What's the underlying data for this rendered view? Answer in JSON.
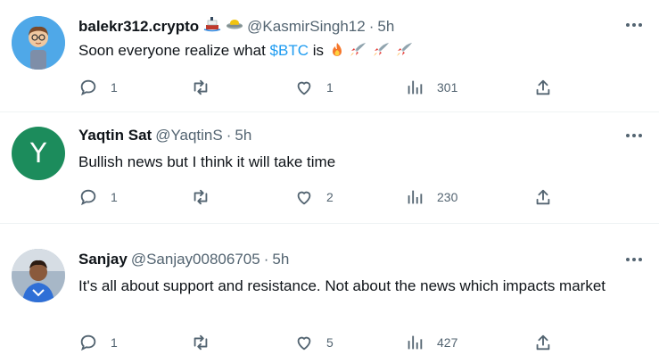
{
  "colors": {
    "accent": "#1d9bf0",
    "muted": "#536471",
    "text": "#0f1419"
  },
  "tweets": [
    {
      "name": "balekr312.crypto",
      "badges": [
        "ship-emoji",
        "flying-saucer-emoji"
      ],
      "handle": "@KasmirSingh12",
      "separator": "·",
      "time": "5h",
      "text_before": "Soon everyone realize what ",
      "cashtag": "$BTC",
      "text_after": " is ",
      "emojis": [
        "fire-emoji",
        "rocket-emoji",
        "rocket-emoji",
        "rocket-emoji"
      ],
      "replies": "1",
      "retweets": "",
      "likes": "1",
      "views": "301"
    },
    {
      "name": "Yaqtin Sat",
      "avatar_letter": "Y",
      "handle": "@YaqtinS",
      "separator": "·",
      "time": "5h",
      "text": "Bullish news but I think it will take time",
      "replies": "1",
      "retweets": "",
      "likes": "2",
      "views": "230"
    },
    {
      "name": "Sanjay",
      "handle": "@Sanjay00806705",
      "separator": "·",
      "time": "5h",
      "text": "It's all about support and resistance. Not about the news which impacts market",
      "replies": "1",
      "retweets": "",
      "likes": "5",
      "views": "427"
    }
  ]
}
